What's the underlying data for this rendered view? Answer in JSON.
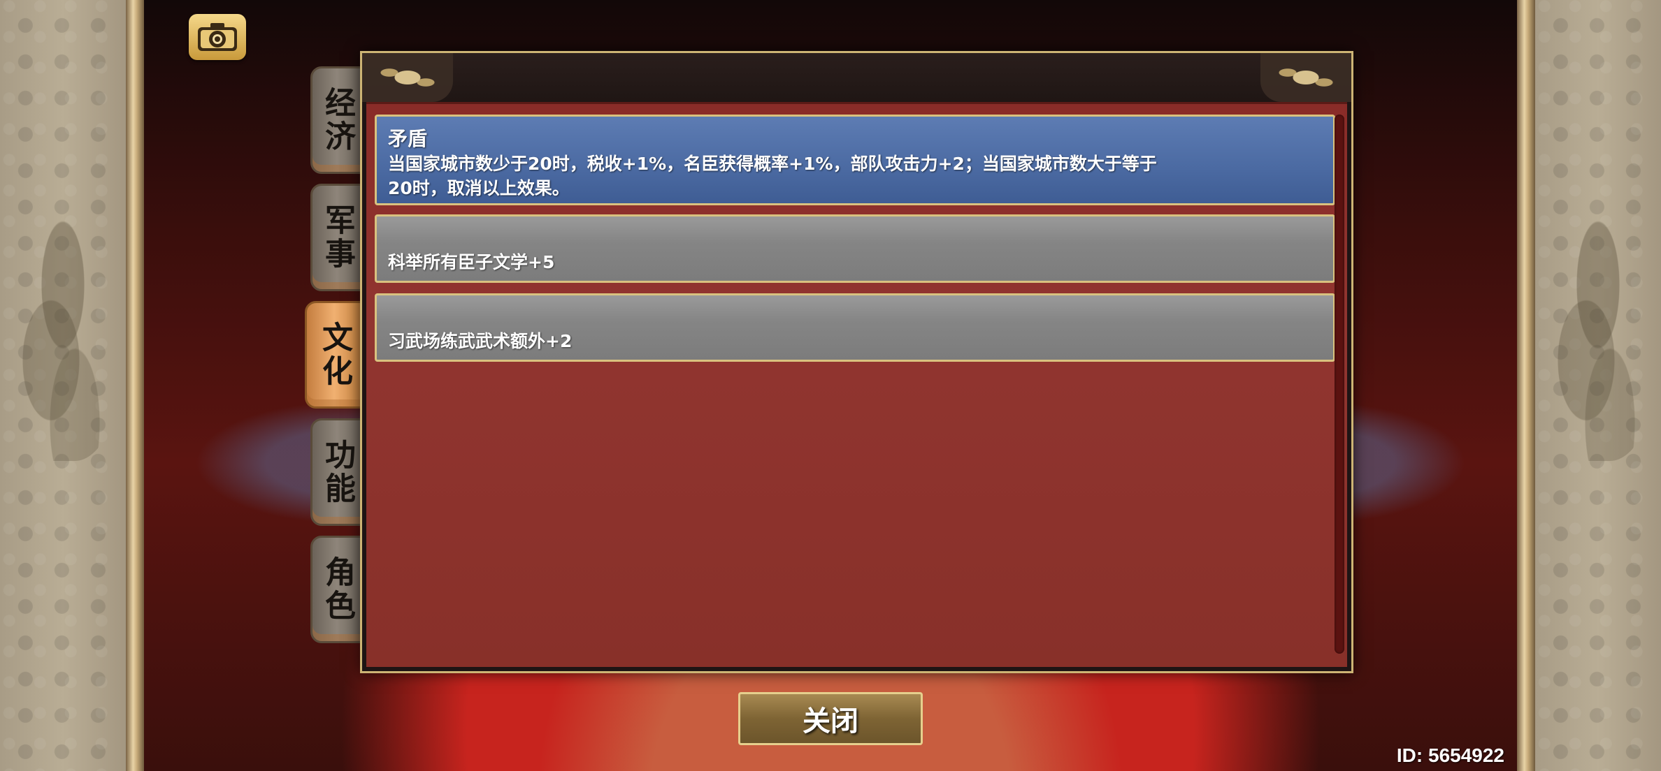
{
  "toolbar": {
    "screenshot_icon": "camera-icon"
  },
  "tabs": [
    {
      "label": "经济",
      "active": false
    },
    {
      "label": "军事",
      "active": false
    },
    {
      "label": "文化",
      "active": true
    },
    {
      "label": "功能",
      "active": false
    },
    {
      "label": "角色",
      "active": false
    }
  ],
  "list": [
    {
      "title": "矛盾",
      "description": "当国家城市数少于20时，税收+1%，名臣获得概率+1%，部队攻击力+2；当国家城市数大于等于20时，取消以上效果。",
      "selected": true
    },
    {
      "title": "",
      "description": "科举所有臣子文学+5",
      "selected": false
    },
    {
      "title": "",
      "description": "习武场练武武术额外+2",
      "selected": false
    }
  ],
  "close_label": "关闭",
  "player_id": "ID: 5654922",
  "colors": {
    "selected_item": "#4b6aa2",
    "normal_item": "#858585",
    "panel": "#913530",
    "gold_border": "#d9c27f"
  }
}
